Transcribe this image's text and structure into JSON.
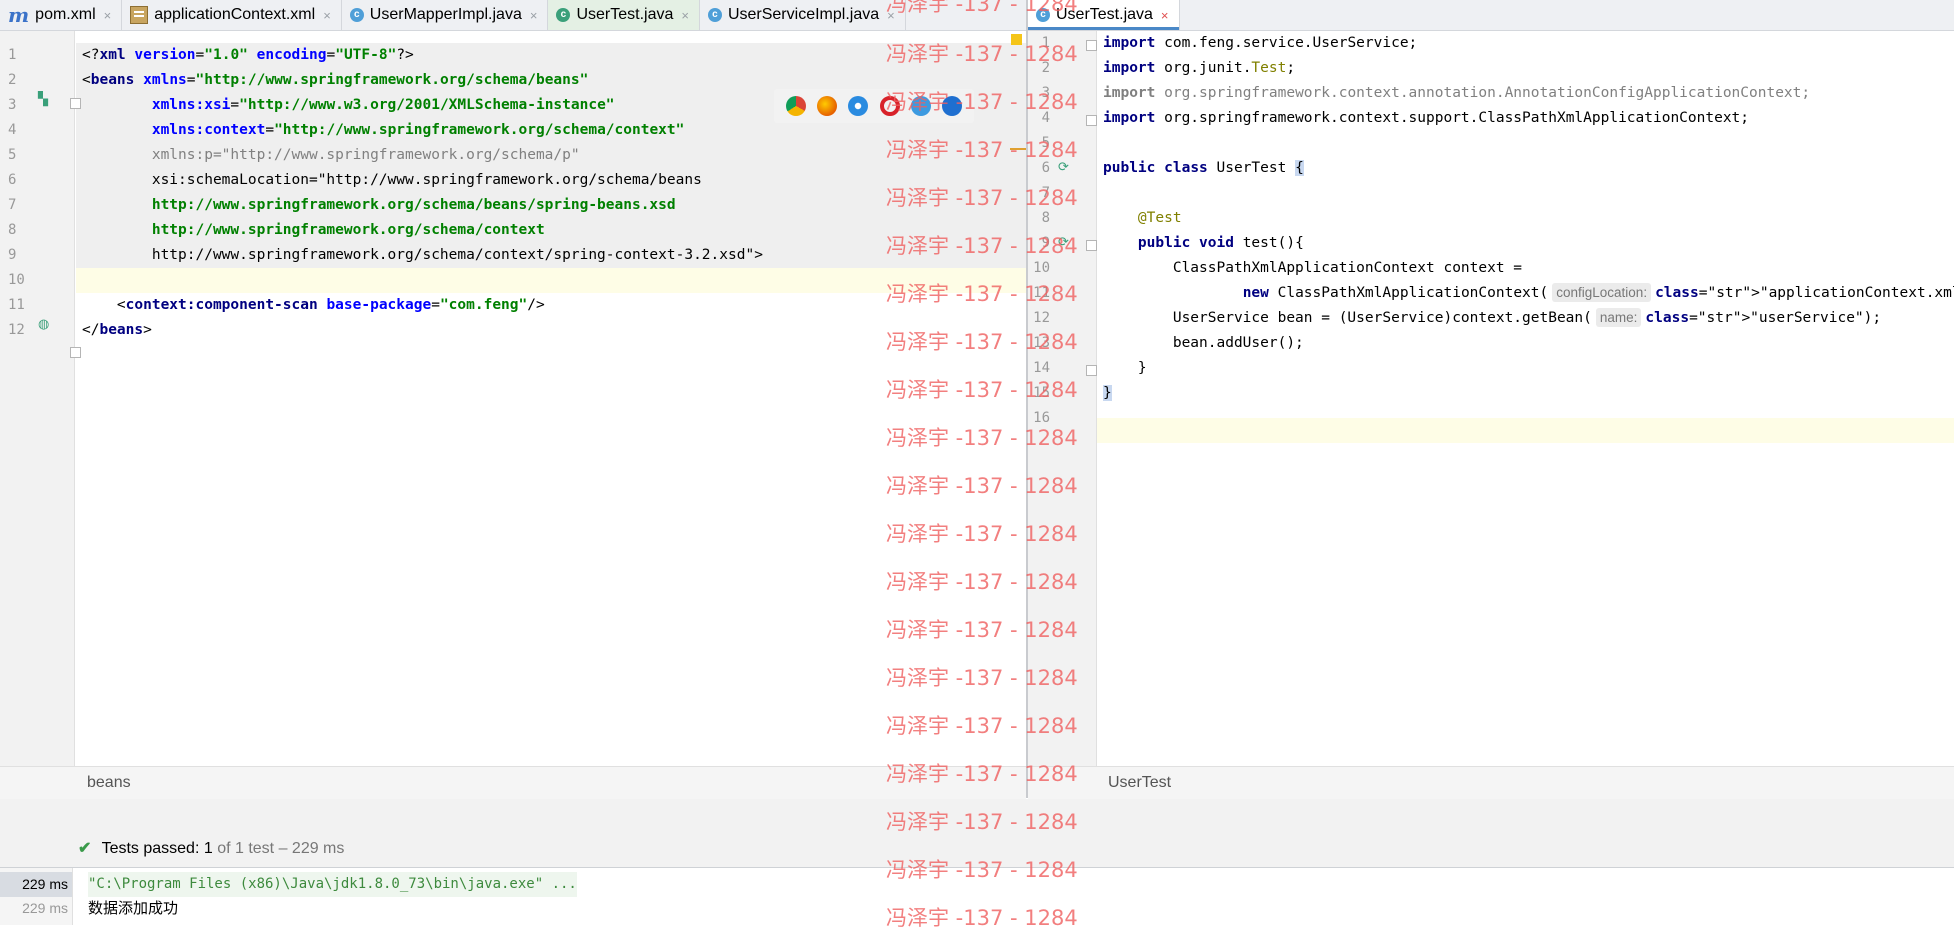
{
  "tabs_left": [
    {
      "label": "pom.xml",
      "icon": "maven-m-icon",
      "active": false,
      "close": "×"
    },
    {
      "label": "applicationContext.xml",
      "icon": "xml-file-icon",
      "active": false,
      "close": "×"
    },
    {
      "label": "UserMapperImpl.java",
      "icon": "java-class-icon",
      "active": false,
      "close": "×"
    },
    {
      "label": "UserTest.java",
      "icon": "java-test-class-icon",
      "active": true,
      "close": "×"
    },
    {
      "label": "UserServiceImpl.java",
      "icon": "java-class-icon",
      "active": false,
      "close": "×"
    }
  ],
  "tabs_right": [
    {
      "label": "UserTest.java",
      "icon": "java-class-icon",
      "active": true,
      "close": "×"
    }
  ],
  "left_editor": {
    "line_numbers": [
      "1",
      "2",
      "3",
      "4",
      "5",
      "6",
      "7",
      "8",
      "9",
      "10",
      "11",
      "12"
    ],
    "lines": [
      "<?xml version=\"1.0\" encoding=\"UTF-8\"?>",
      "<beans xmlns=\"http://www.springframework.org/schema/beans\"",
      "        xmlns:xsi=\"http://www.w3.org/2001/XMLSchema-instance\"",
      "        xmlns:context=\"http://www.springframework.org/schema/context\"",
      "        xmlns:p=\"http://www.springframework.org/schema/p\"",
      "        xsi:schemaLocation=\"http://www.springframework.org/schema/beans",
      "        http://www.springframework.org/schema/beans/spring-beans.xsd",
      "        http://www.springframework.org/schema/context",
      "        http://www.springframework.org/schema/context/spring-context-3.2.xsd\">",
      "",
      "    <context:component-scan base-package=\"com.feng\"/>",
      "</beans>"
    ]
  },
  "right_editor": {
    "line_numbers": [
      "1",
      "2",
      "3",
      "4",
      "5",
      "6",
      "7",
      "8",
      "9",
      "10",
      "11",
      "12",
      "13",
      "14",
      "15",
      "16"
    ],
    "lines": [
      "import com.feng.service.UserService;",
      "import org.junit.Test;",
      "import org.springframework.context.annotation.AnnotationConfigApplicationContext;",
      "import org.springframework.context.support.ClassPathXmlApplicationContext;",
      "",
      "public class UserTest {",
      "",
      "    @Test",
      "    public void test(){",
      "        ClassPathXmlApplicationContext context =",
      "                new ClassPathXmlApplicationContext(configLocation: \"applicationContext.xml\");",
      "        UserService bean = (UserService)context.getBean(name: \"userService\");",
      "        bean.addUser();",
      "    }",
      "}",
      ""
    ],
    "hints": {
      "config_location": "configLocation:",
      "name": "name:"
    }
  },
  "breadcrumb_left": "beans",
  "breadcrumb_right": "UserTest",
  "test_status": {
    "icon": "check-icon",
    "prefix": "Tests passed:",
    "count": "1",
    "suffix": "of 1 test – 229 ms"
  },
  "console": {
    "times": [
      "229 ms",
      "229 ms"
    ],
    "lines": [
      "\"C:\\Program Files (x86)\\Java\\jdk1.8.0_73\\bin\\java.exe\" ...",
      "数据添加成功"
    ]
  },
  "watermark_text": "冯泽宇 -137 - 1284",
  "browser_icons": [
    "chrome-icon",
    "firefox-icon",
    "safari-icon",
    "opera-icon",
    "ie-icon",
    "edge-icon"
  ],
  "colors": {
    "keyword": "#000080",
    "string": "#008000",
    "attribute": "#0000ff",
    "annotation": "#808000",
    "watermark": "#f06060",
    "tab_active_underline": "#4a88c7"
  }
}
